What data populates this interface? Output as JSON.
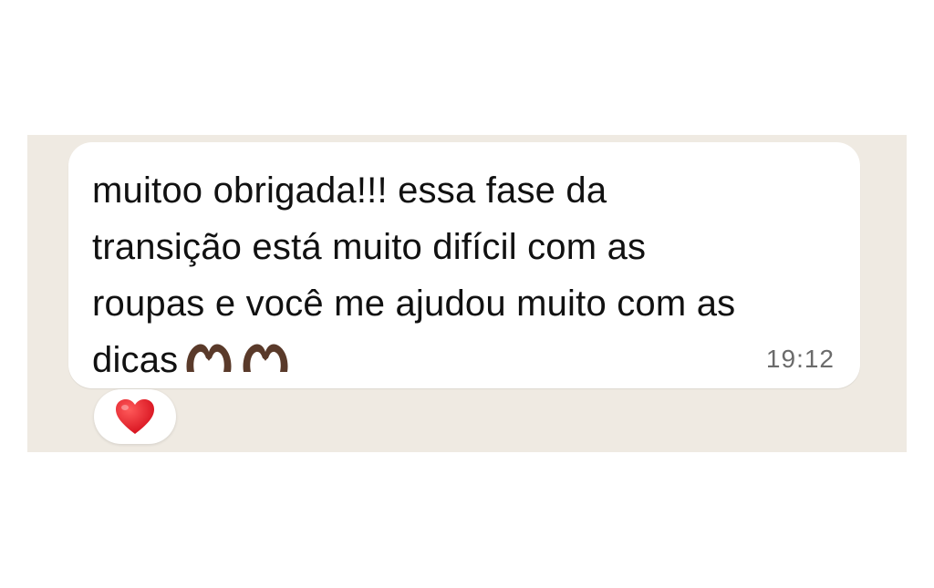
{
  "message": {
    "lines": [
      "muitoo obrigada!!! essa fase da",
      "transição está muito difícil com as",
      "roupas e você me ajudou muito com as",
      "dicas"
    ],
    "emoji": [
      "heart-hands-icon",
      "heart-hands-icon"
    ],
    "time": "19:12"
  },
  "reaction": {
    "emoji": "red-heart-icon"
  },
  "colors": {
    "chat_background": "#efeae2",
    "bubble": "#ffffff",
    "text": "#111111",
    "timestamp": "#6b6b6b",
    "heart": "#e0121f",
    "heart_hands": "#5a3a2a"
  }
}
